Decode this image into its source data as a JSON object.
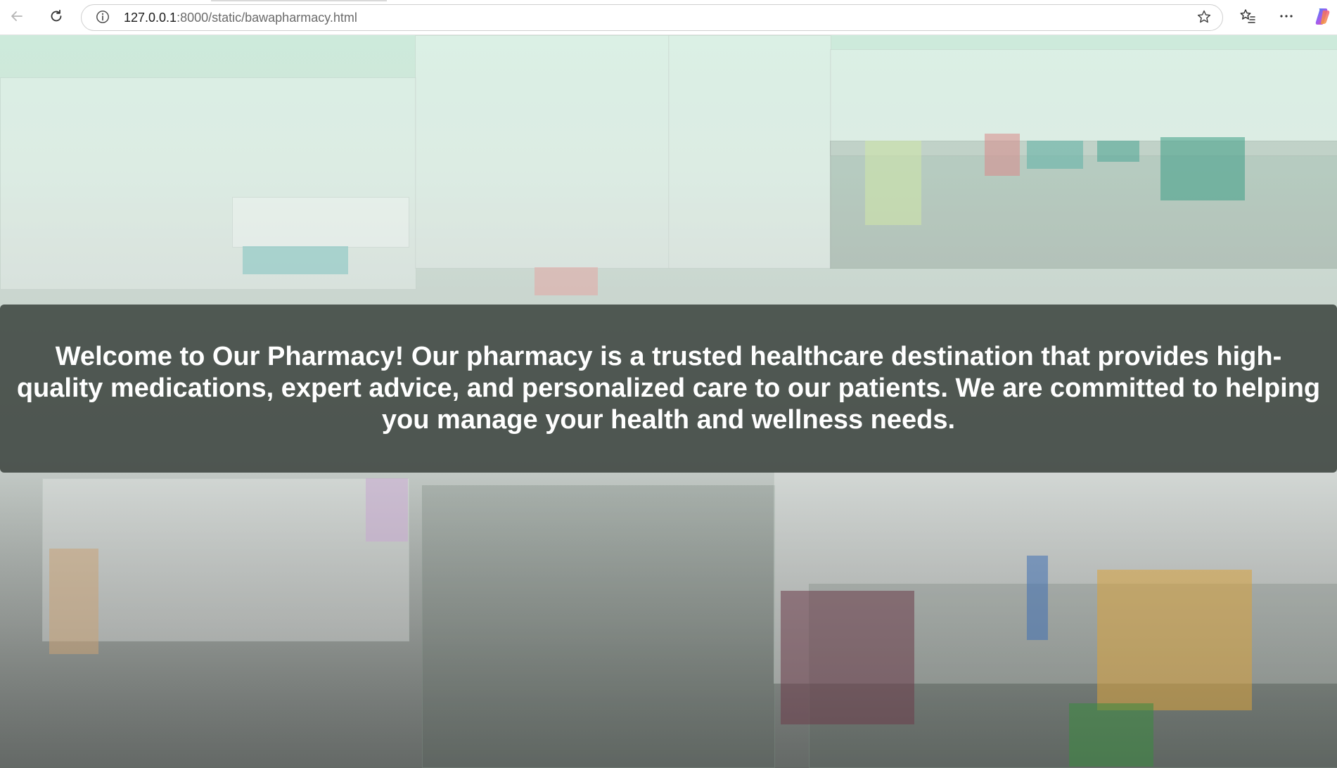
{
  "browser": {
    "url_host": "127.0.0.1",
    "url_path": ":8000/static/bawapharmacy.html",
    "icons": {
      "back": "back-arrow-icon",
      "reload": "reload-icon",
      "site_info": "info-icon",
      "favorite": "star-icon",
      "favorites_bar": "favorites-icon",
      "more": "more-icon",
      "copilot": "copilot-icon"
    }
  },
  "page": {
    "welcome_message": "Welcome to Our Pharmacy! Our pharmacy is a trusted healthcare destination that provides high-quality medications, expert advice, and personalized care to our patients. We are committed to helping you manage your health and wellness needs."
  },
  "colors": {
    "banner_background": "#2d3430",
    "banner_text": "#ffffff",
    "page_tint": "#cdeadb"
  }
}
